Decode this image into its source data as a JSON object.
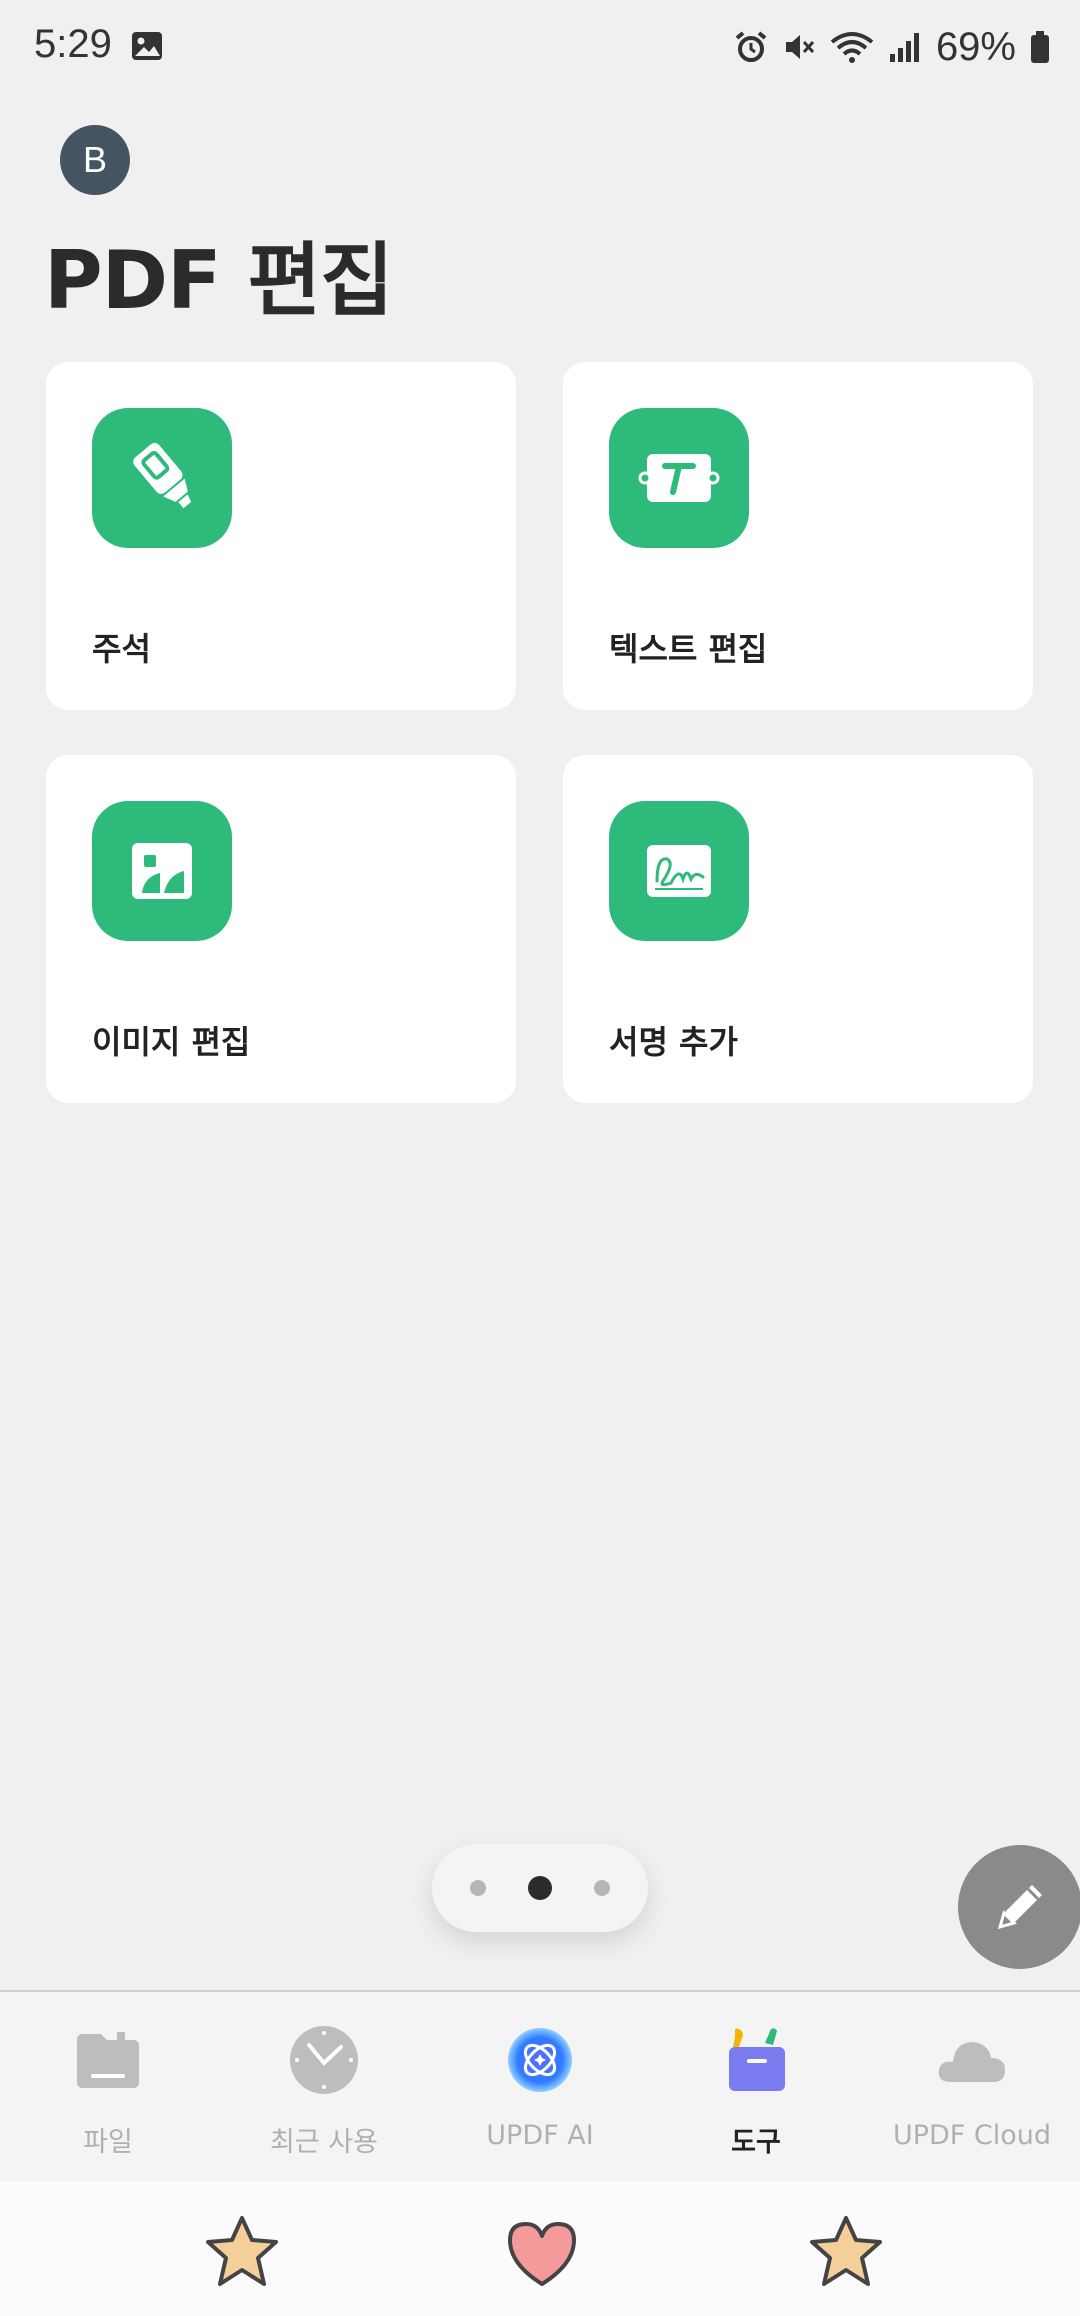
{
  "status_bar": {
    "time": "5:29",
    "battery": "69%",
    "icons": [
      "image-icon",
      "alarm-icon",
      "mute-icon",
      "wifi-icon",
      "signal-icon",
      "battery-icon"
    ]
  },
  "header": {
    "avatar_letter": "B",
    "title": "PDF 편집"
  },
  "cards": [
    {
      "label": "주석",
      "icon": "highlighter-icon"
    },
    {
      "label": "텍스트 편집",
      "icon": "text-edit-icon"
    },
    {
      "label": "이미지 편집",
      "icon": "image-edit-icon"
    },
    {
      "label": "서명 추가",
      "icon": "signature-icon"
    }
  ],
  "pager": {
    "pages": 3,
    "active_index": 1
  },
  "fab": {
    "icon": "pencil-icon"
  },
  "bottom_nav": [
    {
      "label": "파일",
      "icon": "folder-icon",
      "active": false
    },
    {
      "label": "최근 사용",
      "icon": "clock-icon",
      "active": false
    },
    {
      "label": "UPDF AI",
      "icon": "ai-icon",
      "active": false
    },
    {
      "label": "도구",
      "icon": "toolbox-icon",
      "active": true
    },
    {
      "label": "UPDF Cloud",
      "icon": "cloud-icon",
      "active": false
    }
  ],
  "sticker_bar": {
    "stickers": [
      "star-sticker-icon",
      "heart-sticker-icon",
      "star-sticker-icon"
    ]
  },
  "colors": {
    "accent": "#2dba7b",
    "background": "#f0f0f0",
    "avatar": "#455462",
    "fab": "#8a8a8a"
  }
}
